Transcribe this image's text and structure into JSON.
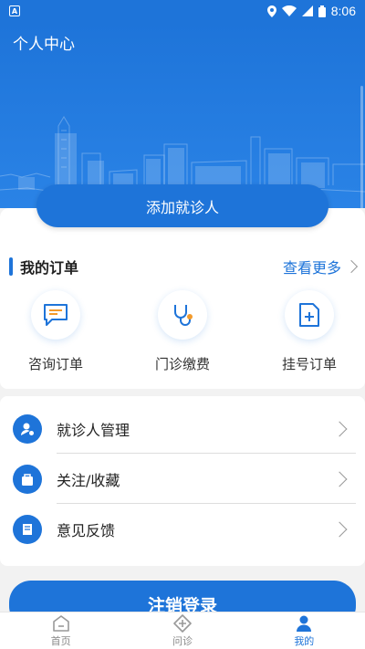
{
  "status_bar": {
    "time": "8:06",
    "app_badge": "A"
  },
  "header": {
    "title": "个人中心"
  },
  "add_patient": {
    "label": "添加就诊人"
  },
  "orders": {
    "title": "我的订单",
    "see_more": "查看更多",
    "items": [
      {
        "label": "咨询订单",
        "icon": "chat-icon"
      },
      {
        "label": "门诊缴费",
        "icon": "stethoscope-icon"
      },
      {
        "label": "挂号订单",
        "icon": "registration-icon"
      }
    ]
  },
  "menu": {
    "items": [
      {
        "label": "就诊人管理",
        "icon": "user-settings-icon"
      },
      {
        "label": "关注/收藏",
        "icon": "favorite-icon"
      },
      {
        "label": "意见反馈",
        "icon": "feedback-icon"
      }
    ]
  },
  "logout": {
    "label": "注销登录"
  },
  "tabs": [
    {
      "label": "首页",
      "icon": "home-icon",
      "active": false
    },
    {
      "label": "问诊",
      "icon": "consult-icon",
      "active": false
    },
    {
      "label": "我的",
      "icon": "profile-icon",
      "active": true
    }
  ],
  "colors": {
    "primary": "#1e74d9",
    "background": "#f2f2f2"
  }
}
